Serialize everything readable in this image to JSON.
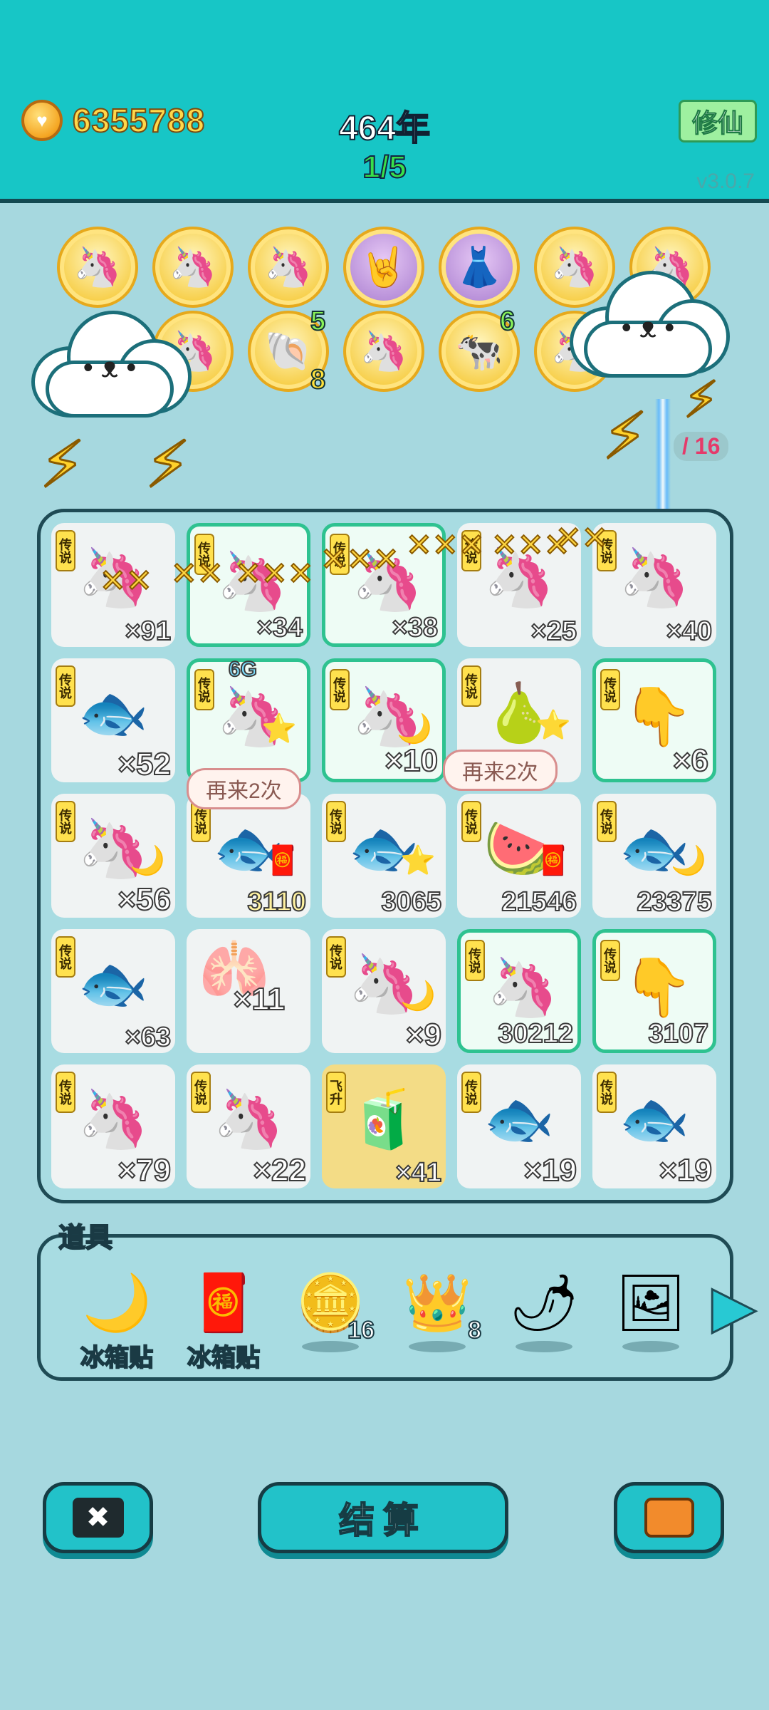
{
  "header": {
    "coins": "6355788",
    "year": "464年",
    "progress": "1/5",
    "xiuxian_label": "修仙",
    "version": "v3.0.7"
  },
  "collection": {
    "medals": [
      {
        "icon": "unicorn-icon",
        "glyph": "🦄"
      },
      {
        "icon": "unicorn-icon",
        "glyph": "🦄"
      },
      {
        "icon": "unicorn-icon",
        "glyph": "🦄"
      },
      {
        "icon": "rock-hand-icon",
        "glyph": "🤘"
      },
      {
        "icon": "skirt-icon",
        "glyph": "👗"
      },
      {
        "icon": "unicorn-icon",
        "glyph": "🦄"
      },
      {
        "icon": "unicorn-icon",
        "glyph": "🦄"
      },
      {
        "icon": "unicorn-icon",
        "glyph": "🦄"
      },
      {
        "icon": "shell-icon",
        "glyph": "🐚"
      },
      {
        "icon": "unicorn-icon",
        "glyph": "🦄"
      },
      {
        "icon": "cows-icon",
        "glyph": "🐄"
      },
      {
        "icon": "unicorn-icon",
        "glyph": "🦄"
      }
    ],
    "badge_shell_top": "5",
    "badge_shell_bottom": "8",
    "badge_cows": "6",
    "goal": "/ 16"
  },
  "board": {
    "legend_tag": "传说",
    "fly_tag": "飞升",
    "bubble_text": "再来2次",
    "cells": [
      {
        "glyph": "🦄",
        "count": "×91"
      },
      {
        "glyph": "🦄",
        "count": "×34"
      },
      {
        "glyph": "🦄",
        "count": "×38"
      },
      {
        "glyph": "🦄",
        "count": "×25"
      },
      {
        "glyph": "🦄",
        "count": "×40"
      },
      {
        "glyph": "🐟",
        "count": "×52"
      },
      {
        "glyph": "🦄",
        "count": "6G"
      },
      {
        "glyph": "🦄",
        "count": "×10"
      },
      {
        "glyph": "🍐",
        "count": ""
      },
      {
        "glyph": "👇",
        "count": "×6"
      },
      {
        "glyph": "🦄",
        "count": "×56"
      },
      {
        "glyph": "🐟",
        "count": "3110"
      },
      {
        "glyph": "🐟",
        "count": "3065"
      },
      {
        "glyph": "🍉",
        "count": "21546"
      },
      {
        "glyph": "🐟",
        "count": "23375"
      },
      {
        "glyph": "🐟",
        "count": "×63"
      },
      {
        "glyph": "🫁",
        "count": "×11"
      },
      {
        "glyph": "🦄",
        "count": "×9"
      },
      {
        "glyph": "🦄",
        "count": "30212"
      },
      {
        "glyph": "👇",
        "count": "3107"
      },
      {
        "glyph": "🦄",
        "count": "×79"
      },
      {
        "glyph": "🦄",
        "count": "×22"
      },
      {
        "glyph": "🧃",
        "count": "×41"
      },
      {
        "glyph": "🐟",
        "count": "×19"
      },
      {
        "glyph": "🐟",
        "count": "×19"
      }
    ]
  },
  "tools": {
    "title": "道具",
    "items": [
      {
        "icon": "moon-icon",
        "glyph": "🌙",
        "label": "冰箱贴",
        "count": ""
      },
      {
        "icon": "fu-icon",
        "glyph": "🧧",
        "label": "冰箱贴",
        "count": ""
      },
      {
        "icon": "dollar-coin-icon",
        "glyph": "🪙",
        "label": "",
        "count": "16"
      },
      {
        "icon": "crown-icon",
        "glyph": "👑",
        "label": "",
        "count": "8"
      },
      {
        "icon": "chili-icon",
        "glyph": "🌶",
        "label": "",
        "count": ""
      },
      {
        "icon": "frame-icon",
        "glyph": "🖼",
        "label": "",
        "count": ""
      }
    ]
  },
  "footer": {
    "settle_label": "结算",
    "close_glyph": "✖"
  }
}
